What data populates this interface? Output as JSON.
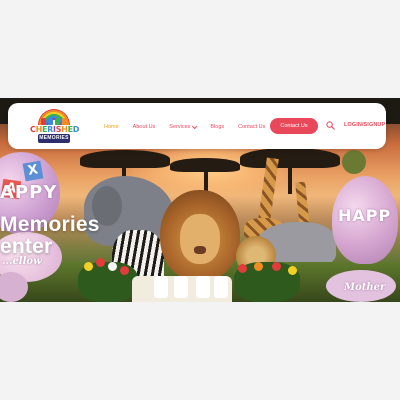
{
  "brand": {
    "logo_line1": [
      "C",
      "H",
      "E",
      "R",
      "I",
      "S",
      "H",
      "E",
      "D"
    ],
    "logo_line2": "MEMORIES"
  },
  "nav": {
    "items": [
      {
        "label": "Home",
        "active": true
      },
      {
        "label": "About Us",
        "active": false
      },
      {
        "label": "Services",
        "active": false,
        "has_dropdown": true
      },
      {
        "label": "Blogs",
        "active": false
      },
      {
        "label": "Contact Us",
        "active": false
      }
    ],
    "cta_label": "Contact Us",
    "login_label": "LOGIN/SIGNUP",
    "search_icon": "search-icon"
  },
  "hero": {
    "title_line1": "Memories",
    "title_line2": "enter",
    "balloon_left_text": "APPY",
    "balloon_right_text": "HAPP",
    "balloon_left_small": "...ellow",
    "balloon_right_small": "Mother",
    "block_x": "X",
    "block_a": "A"
  },
  "colors": {
    "accent": "#e8485a",
    "active_nav": "#f0a21a",
    "page_bg": "#f3f3f3"
  }
}
